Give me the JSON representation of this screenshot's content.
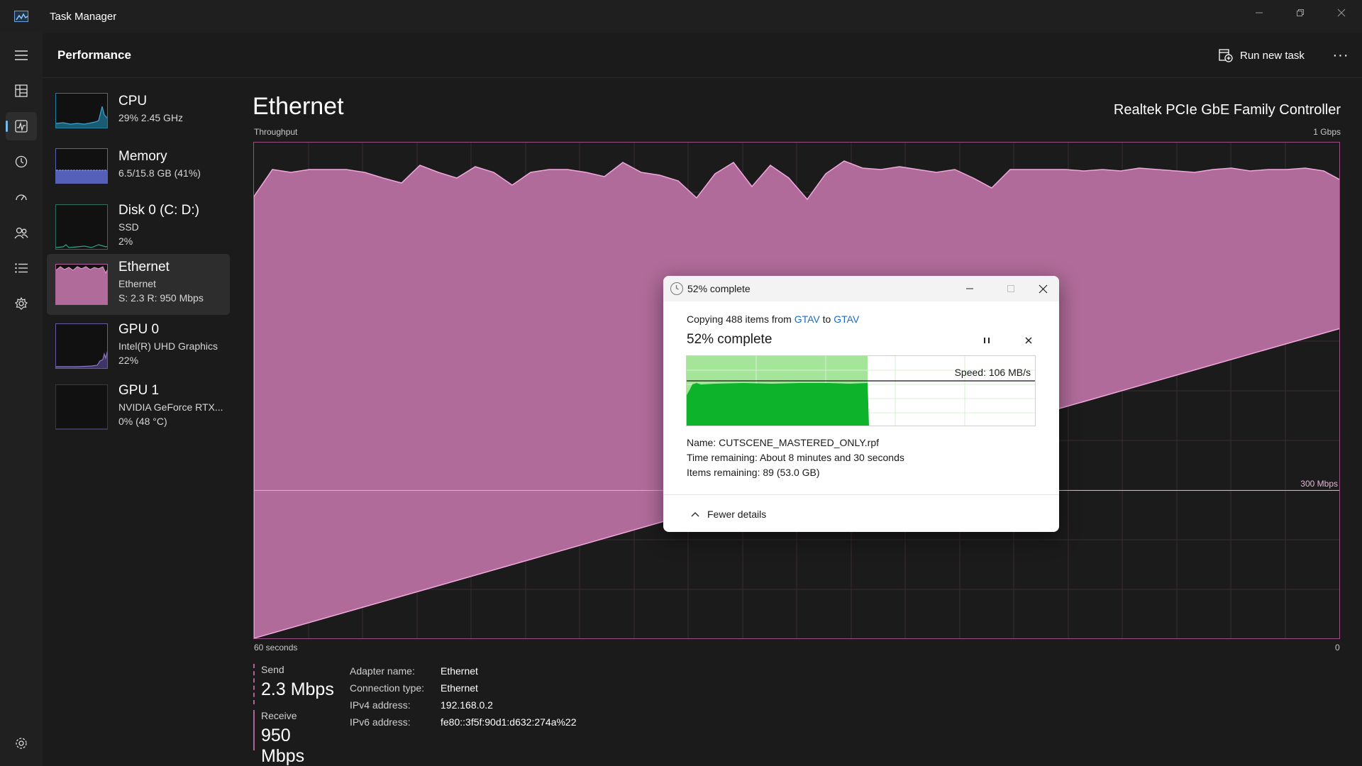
{
  "app": {
    "title": "Task Manager"
  },
  "header": {
    "page_title": "Performance",
    "run_new_task": "Run new task",
    "more": "···"
  },
  "sidebar": {
    "devices": [
      {
        "name": "CPU",
        "line1": "29%  2.45 GHz",
        "line2": ""
      },
      {
        "name": "Memory",
        "line1": "6.5/15.8 GB (41%)",
        "line2": ""
      },
      {
        "name": "Disk 0 (C: D:)",
        "line1": "SSD",
        "line2": "2%"
      },
      {
        "name": "Ethernet",
        "line1": "Ethernet",
        "line2": "S: 2.3  R: 950 Mbps"
      },
      {
        "name": "GPU 0",
        "line1": "Intel(R) UHD Graphics",
        "line2": "22%"
      },
      {
        "name": "GPU 1",
        "line1": "NVIDIA GeForce RTX...",
        "line2": "0% (48 °C)"
      }
    ]
  },
  "main": {
    "title": "Ethernet",
    "adapter_model": "Realtek PCIe GbE Family Controller",
    "throughput_label": "Throughput",
    "max_label": "1 Gbps",
    "mid_label": "300 Mbps",
    "time_label": "60 seconds",
    "zero_label": "0"
  },
  "stats": {
    "send_label": "Send",
    "send_value": "2.3 Mbps",
    "receive_label": "Receive",
    "receive_value": "950 Mbps",
    "adapter_name_key": "Adapter name:",
    "adapter_name_val": "Ethernet",
    "connection_type_key": "Connection type:",
    "connection_type_val": "Ethernet",
    "ipv4_key": "IPv4 address:",
    "ipv4_val": "192.168.0.2",
    "ipv6_key": "IPv6 address:",
    "ipv6_val": "fe80::3f5f:90d1:d632:274a%22"
  },
  "copy_dialog": {
    "title": "52% complete",
    "copying_prefix": "Copying 488 items from ",
    "source": "GTAV",
    "to": " to ",
    "dest": "GTAV",
    "percent_text": "52% complete",
    "progress": 0.52,
    "speed": "Speed: 106 MB/s",
    "name_line": "Name:  CUTSCENE_MASTERED_ONLY.rpf",
    "time_line": "Time remaining:  About 8 minutes and 30 seconds",
    "items_line": "Items remaining:  89 (53.0 GB)",
    "fewer_details": "Fewer details"
  },
  "colors": {
    "accent_pink": "#b06399",
    "graph_fill": "#b06b9a",
    "copy_green": "#0db32b",
    "copy_light_green": "#a4e59a"
  }
}
